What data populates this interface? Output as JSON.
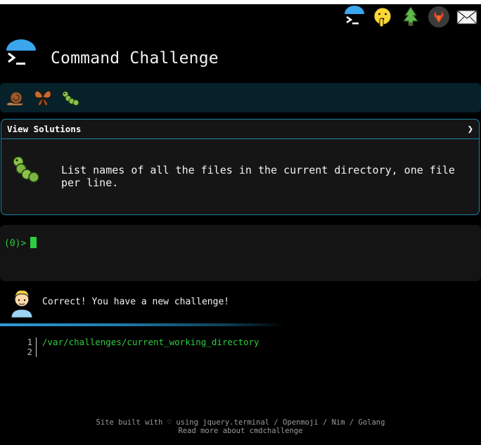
{
  "app": {
    "title": "Command Challenge"
  },
  "topbar": {
    "icons": [
      "terminal-icon",
      "shushing-face-icon",
      "tree-icon",
      "gitlab-icon",
      "mail-icon"
    ]
  },
  "levels": {
    "icons": [
      "snail-icon",
      "butterfly-icon",
      "caterpillar-icon"
    ]
  },
  "challenge": {
    "solutions_label": "View Solutions",
    "solutions_arrow": "❯",
    "icon": "caterpillar-icon",
    "description": "List names of all the files in the current directory, one file per line."
  },
  "terminal": {
    "prompt": "(0)>"
  },
  "result": {
    "avatar": "person-icon",
    "message": "Correct! You have a new challenge!"
  },
  "editor": {
    "line_numbers": [
      "1",
      "2"
    ],
    "path": "/var/challenges/current_working_directory"
  },
  "footer": {
    "line1": "Site built with ♡ using jquery.terminal / Openmoji / Nim / Golang",
    "line2": "Read more about cmdchallenge"
  },
  "colors": {
    "accent": "#1a86a8",
    "prompt_green": "#2ecc40",
    "level_bar": "#062129"
  }
}
